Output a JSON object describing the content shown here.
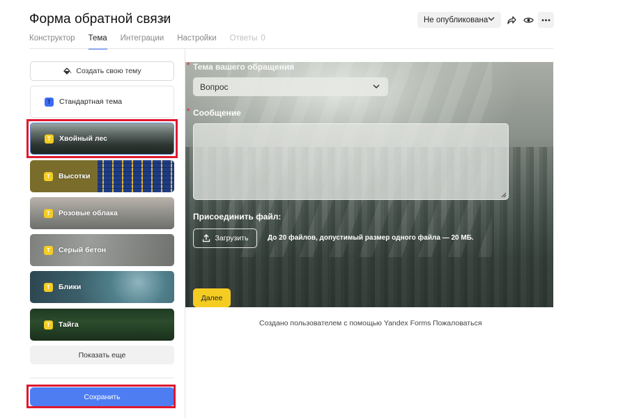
{
  "header": {
    "title": "Форма обратной связи",
    "tabs": [
      {
        "label": "Конструктор"
      },
      {
        "label": "Тема"
      },
      {
        "label": "Интеграции"
      },
      {
        "label": "Настройки"
      },
      {
        "label": "Ответы",
        "count": "0"
      }
    ],
    "active_tab": "Тема",
    "status_label": "Не опубликована"
  },
  "sidebar": {
    "create_theme_label": "Создать свою тему",
    "badge_letter": "T",
    "themes": [
      {
        "label": "Стандартная тема"
      },
      {
        "label": "Хвойный лес",
        "selected": true
      },
      {
        "label": "Высотки"
      },
      {
        "label": "Розовые облака"
      },
      {
        "label": "Серый бетон"
      },
      {
        "label": "Блики"
      },
      {
        "label": "Тайга"
      }
    ],
    "show_more_label": "Показать еще",
    "save_label": "Сохранить"
  },
  "form": {
    "topic_label": "Тема вашего обращения",
    "topic_value": "Вопрос",
    "message_label": "Сообщение",
    "required_mark": "*",
    "attach_label": "Присоединить файл:",
    "upload_label": "Загрузить",
    "upload_hint": "До 20 файлов, допустимый размер одного файла — 20 МБ.",
    "next_label": "Далее"
  },
  "footer": {
    "created_text": "Создано пользователем с помощью Yandex Forms",
    "report_label": "Пожаловаться"
  },
  "colors": {
    "accent": "#3b6cf6",
    "save_button": "#4e7df2",
    "next_button": "#f5cc22",
    "highlight": "#e0182d"
  }
}
